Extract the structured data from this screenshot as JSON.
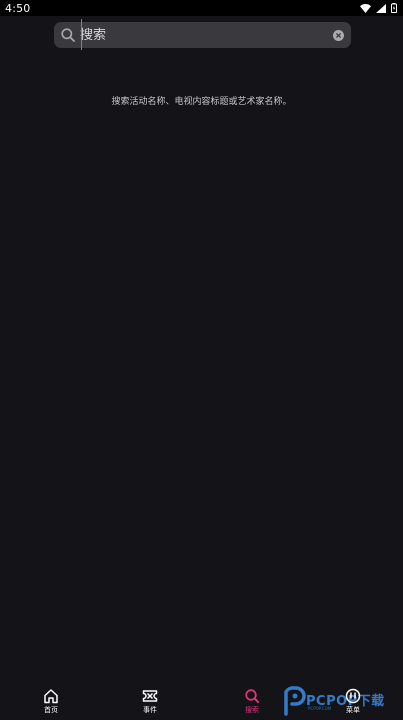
{
  "status_bar": {
    "time": "4:50"
  },
  "search": {
    "value": "搜索",
    "placeholder": "搜索"
  },
  "hint": "搜索活动名称、电视内容标题或艺术家名称。",
  "nav": {
    "items": [
      {
        "label": "首页",
        "icon": "home-icon",
        "active": false
      },
      {
        "label": "事件",
        "icon": "ticket-icon",
        "active": false
      },
      {
        "label": "搜索",
        "icon": "search-icon",
        "active": true
      },
      {
        "label": "菜单",
        "icon": "menu-icon",
        "active": false
      }
    ]
  },
  "watermark": {
    "text": "PCPOP下载",
    "sub": "PCPOP.COM"
  },
  "colors": {
    "background": "#141418",
    "accent": "#e0317c",
    "search_bg": "#3a3a3e",
    "cursor": "#2fae8a",
    "watermark": "#3a8ee6"
  }
}
